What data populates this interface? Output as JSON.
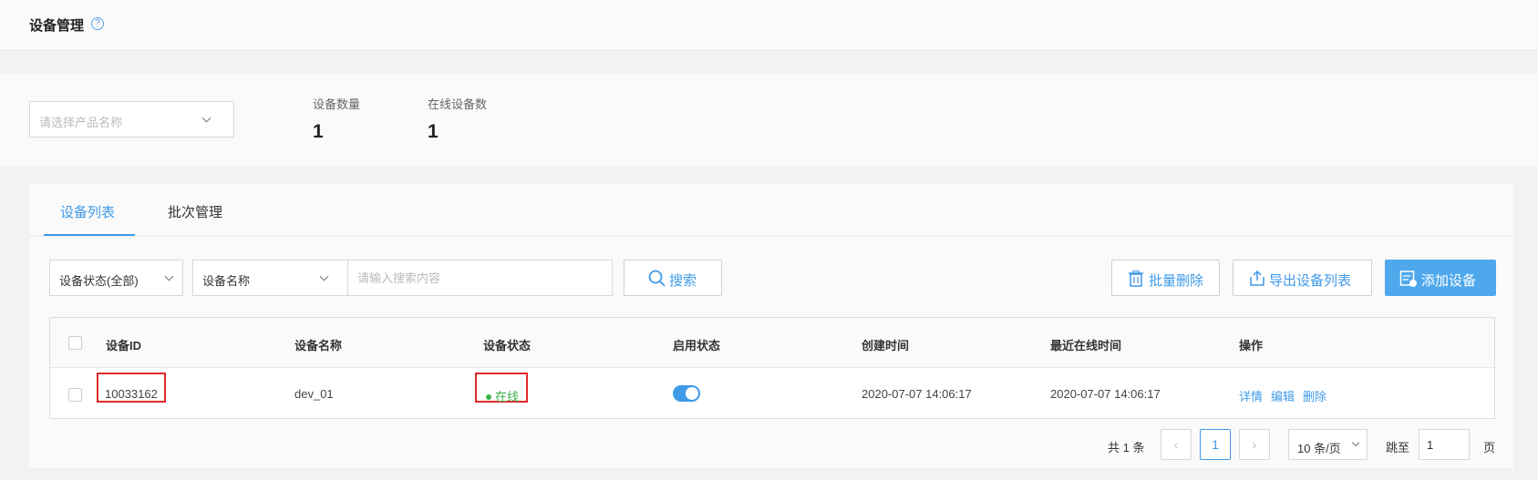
{
  "header": {
    "title": "设备管理",
    "help_icon": "question-circle-icon",
    "help_symbol": "?"
  },
  "stats": {
    "product_select_placeholder": "请选择产品名称",
    "device_count_label": "设备数量",
    "device_count_value": "1",
    "online_count_label": "在线设备数",
    "online_count_value": "1"
  },
  "tabs": [
    {
      "label": "设备列表",
      "active": true
    },
    {
      "label": "批次管理",
      "active": false
    }
  ],
  "filters": {
    "status_select": "设备状态(全部)",
    "field_select": "设备名称",
    "search_placeholder": "请输入搜索内容",
    "search_button": "搜索"
  },
  "actions": {
    "batch_delete": "批量删除",
    "export_list": "导出设备列表",
    "add_device": "添加设备"
  },
  "table": {
    "columns": [
      "设备ID",
      "设备名称",
      "设备状态",
      "启用状态",
      "创建时间",
      "最近在线时间",
      "操作"
    ],
    "rows": [
      {
        "device_id": "10033162",
        "device_name": "dev_01",
        "status": "在线",
        "enabled": true,
        "created_at": "2020-07-07 14:06:17",
        "last_online": "2020-07-07 14:06:17",
        "ops": [
          "详情",
          "编辑",
          "删除"
        ]
      }
    ]
  },
  "pagination": {
    "total_text": "共 1 条",
    "current_page": "1",
    "page_size": "10 条/页",
    "jump_label": "跳至",
    "jump_value": "1",
    "page_unit": "页"
  },
  "colors": {
    "accent": "#3f9ae8",
    "online": "#3bb34a",
    "highlight": "#e0282e"
  }
}
